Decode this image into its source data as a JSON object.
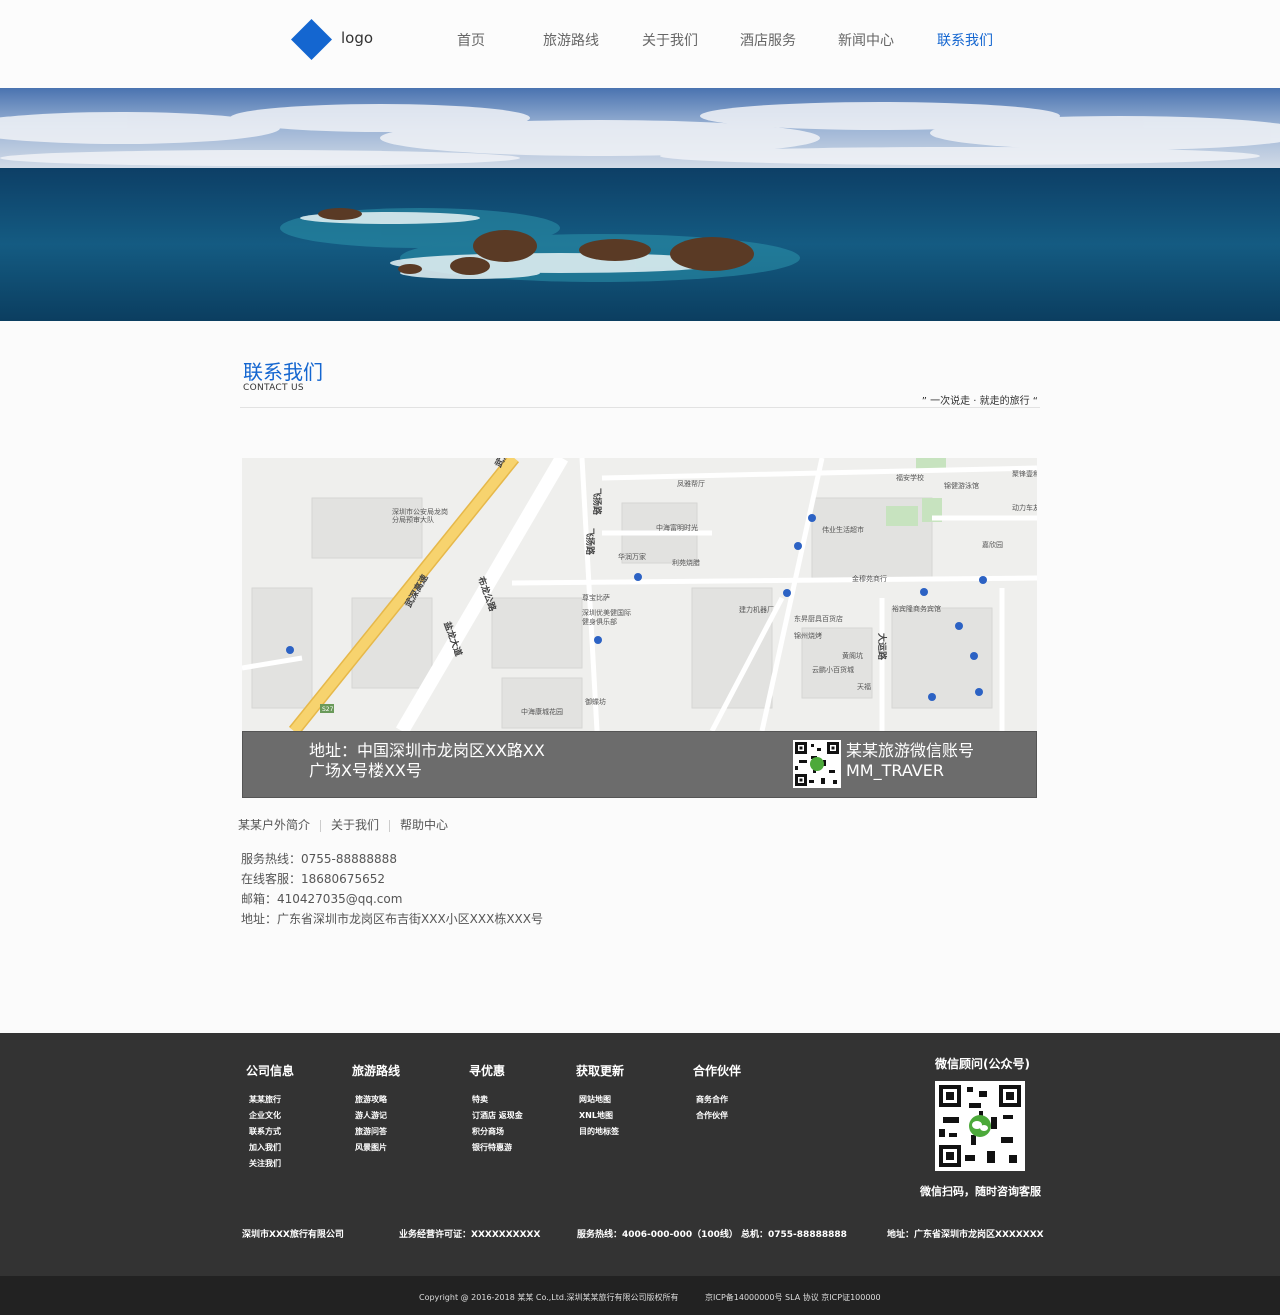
{
  "header": {
    "logo": "logo",
    "nav": [
      "首页",
      "旅游路线",
      "关于我们",
      "酒店服务",
      "新闻中心",
      "联系我们"
    ],
    "active_index": 5
  },
  "section": {
    "title": "联系我们",
    "subtitle": "CONTACT US",
    "slogan": "” 一次说走 · 就走的旅行 “"
  },
  "map": {
    "roads": [
      "武深高速",
      "飞扬路",
      "布龙公路",
      "盐龙大道",
      "大运路",
      "S27"
    ],
    "places": [
      "深圳市公安局龙岗分局预审大队",
      "凤雅帮厅",
      "中海富明时光",
      "华润万家",
      "利苑烧腊",
      "尊宝比萨",
      "深圳优美健国际健身俱乐部",
      "福安学校",
      "锦健游泳馆",
      "伟业生活超市",
      "嘉欣园",
      "金穆苑商行",
      "建力机器厂",
      "东昇厨具百货店",
      "裕宾隆商务宾馆",
      "锦州烧烤",
      "黄阁坑",
      "云鹏小百货城",
      "天福",
      "御蝶坊",
      "中海康城花园",
      "聚锋壹和",
      "动力车友"
    ],
    "info_address_line1": "地址：中国深圳市龙岗区XX路XX",
    "info_address_line2": "广场X号楼XX号",
    "wechat_line1": "某某旅游微信账号",
    "wechat_line2": "MM_TRAVER"
  },
  "sublinks": [
    "某某户外简介",
    "关于我们",
    "帮助中心"
  ],
  "contact": {
    "hotline": "服务热线：0755-88888888",
    "online": "在线客服：18680675652",
    "email": "邮箱：410427035@qq.com",
    "address": "地址：广东省深圳市龙岗区布吉街XXX小区XXX栋XXX号"
  },
  "footer": {
    "columns": [
      {
        "title": "公司信息",
        "items": [
          "某某旅行",
          "企业文化",
          "联系方式",
          "加入我们",
          "关注我们"
        ]
      },
      {
        "title": "旅游路线",
        "items": [
          "旅游攻略",
          "游人游记",
          "旅游问答",
          "风景图片"
        ]
      },
      {
        "title": "寻优惠",
        "items": [
          "特卖",
          "订酒店 返现金",
          "积分商场",
          "银行特惠游"
        ]
      },
      {
        "title": "获取更新",
        "items": [
          "网站地图",
          "XNL地图",
          "目的地标签"
        ]
      },
      {
        "title": "合作伙伴",
        "items": [
          "商务合作",
          "合作伙伴"
        ]
      }
    ],
    "qr_title": "微信顾问(公众号)",
    "qr_caption": "微信扫码，随时咨询客服",
    "company": "深圳市XXX旅行有限公司",
    "license": "业务经营许可证：XXXXXXXXXX",
    "hotline": "服务热线：4006-000-000（100线） 总机：0755-88888888",
    "address": "地址：广东省深圳市龙岗区XXXXXXX"
  },
  "copyright": {
    "text": "Copyright @ 2016-2018 某某 Co.,Ltd.深圳某某旅行有限公司版权所有",
    "icp": "京ICP备14000000号 SLA 协议 京ICP证100000"
  },
  "colors": {
    "accent": "#1466d0",
    "footer_bg": "#333333",
    "copyright_bg": "#222222",
    "map_info_bg": "#6c6c6c"
  }
}
